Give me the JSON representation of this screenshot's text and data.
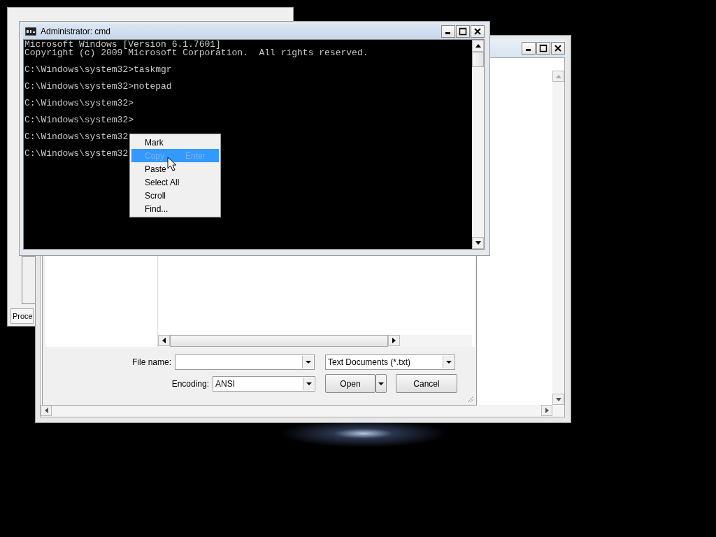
{
  "task_manager": {
    "status_text": "Proce"
  },
  "open_dialog": {
    "file_name": {
      "label": "File name:"
    },
    "file_type": {
      "value": "Text Documents (*.txt)"
    },
    "encoding": {
      "label": "Encoding:",
      "value": "ANSI"
    },
    "buttons": [
      {
        "label": "Open",
        "kind": "split"
      },
      {
        "label": "Cancel",
        "kind": "plain"
      }
    ]
  },
  "cmd_window": {
    "title": "Administrator: cmd",
    "blocks": [
      [
        "Microsoft Windows [Version 6.1.7601]",
        "Copyright (c) 2009 Microsoft Corporation.  All rights reserved."
      ],
      [
        "C:\\Windows\\system32>taskmgr"
      ],
      [
        "C:\\Windows\\system32>notepad"
      ],
      [
        "C:\\Windows\\system32>"
      ],
      [
        "C:\\Windows\\system32>"
      ],
      [
        "C:\\Windows\\system32"
      ],
      [
        "C:\\Windows\\system32"
      ]
    ]
  },
  "context_menu": {
    "items": [
      {
        "label": "Mark",
        "selected": false,
        "disabled": false
      },
      {
        "label": "Copy",
        "shortcut": "Enter",
        "selected": true,
        "disabled": true
      },
      {
        "label": "Paste",
        "selected": false,
        "disabled": false
      },
      {
        "label": "Select All",
        "selected": false,
        "disabled": false
      },
      {
        "label": "Scroll",
        "selected": false,
        "disabled": false
      },
      {
        "label": "Find...",
        "selected": false,
        "disabled": false
      }
    ]
  }
}
